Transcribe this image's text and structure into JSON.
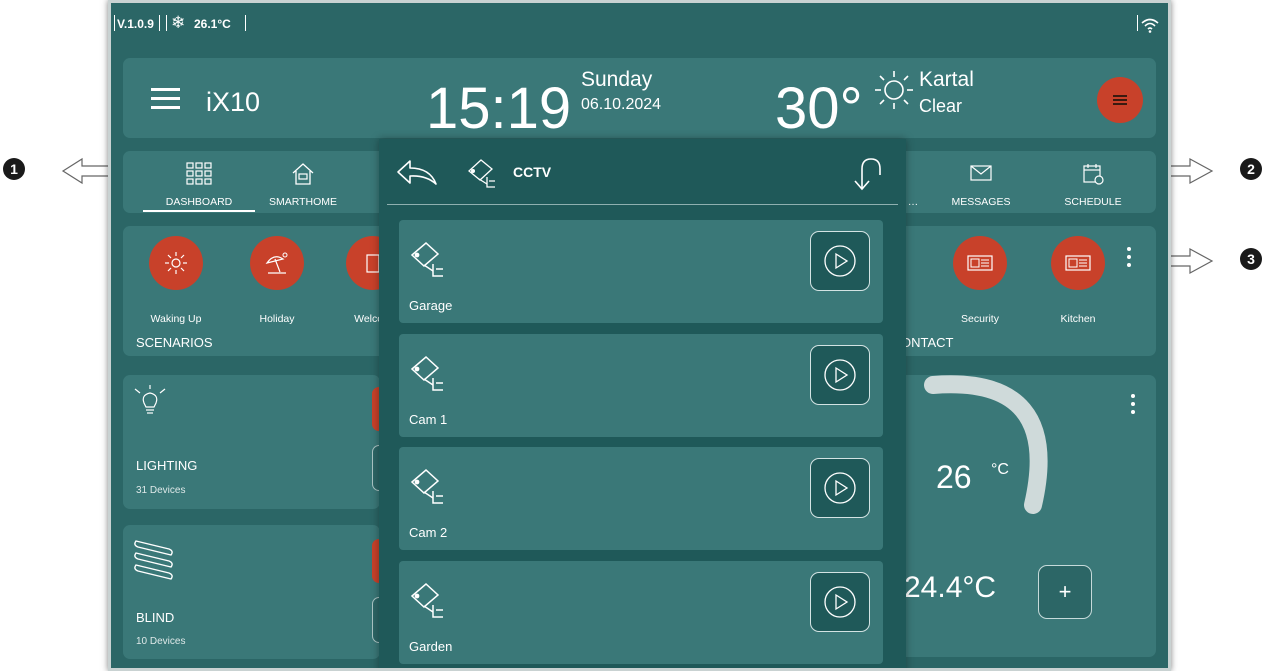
{
  "status_bar": {
    "version": "V.1.0.9",
    "temperature": "26.1°C"
  },
  "header": {
    "app_title": "iX10",
    "time": "15:19",
    "day": "Sunday",
    "date": "06.10.2024",
    "outdoor_temp": "30°",
    "city": "Kartal",
    "condition": "Clear"
  },
  "nav": {
    "items": [
      {
        "label": "DASHBOARD",
        "icon": "dashboard-grid-icon",
        "active": true
      },
      {
        "label": "SMARTHOME",
        "icon": "smarthome-icon"
      },
      {
        "label": "…",
        "icon": ""
      },
      {
        "label": "MESSAGES",
        "icon": "envelope-icon"
      },
      {
        "label": "SCHEDULE",
        "icon": "calendar-clock-icon"
      }
    ]
  },
  "scenarios": {
    "label": "SCENARIOS",
    "items": [
      {
        "label": "Waking Up",
        "icon": "sun-icon"
      },
      {
        "label": "Holiday",
        "icon": "beach-umbrella-icon"
      },
      {
        "label": "Welcom",
        "icon": "door-icon"
      }
    ]
  },
  "contact": {
    "label": "ONTACT",
    "items": [
      {
        "label": "Security",
        "icon": "intercom-icon"
      },
      {
        "label": "Kitchen",
        "icon": "intercom-icon"
      }
    ]
  },
  "lighting": {
    "name": "LIGHTING",
    "count": "31 Devices"
  },
  "blind": {
    "name": "BLIND",
    "count": "10 Devices"
  },
  "climate": {
    "set_temp": "26",
    "unit": "°C",
    "current_temp": "24.4°C",
    "plus": "+"
  },
  "cctv": {
    "title": "CCTV",
    "cameras": [
      {
        "label": "Garage"
      },
      {
        "label": "Cam 1"
      },
      {
        "label": "Cam 2"
      },
      {
        "label": "Garden"
      }
    ]
  },
  "annotations": [
    "1",
    "2",
    "3"
  ],
  "colors": {
    "background": "#2b6666",
    "card": "#3a7878",
    "accent": "#c8412a",
    "overlay": "#1f5959"
  }
}
